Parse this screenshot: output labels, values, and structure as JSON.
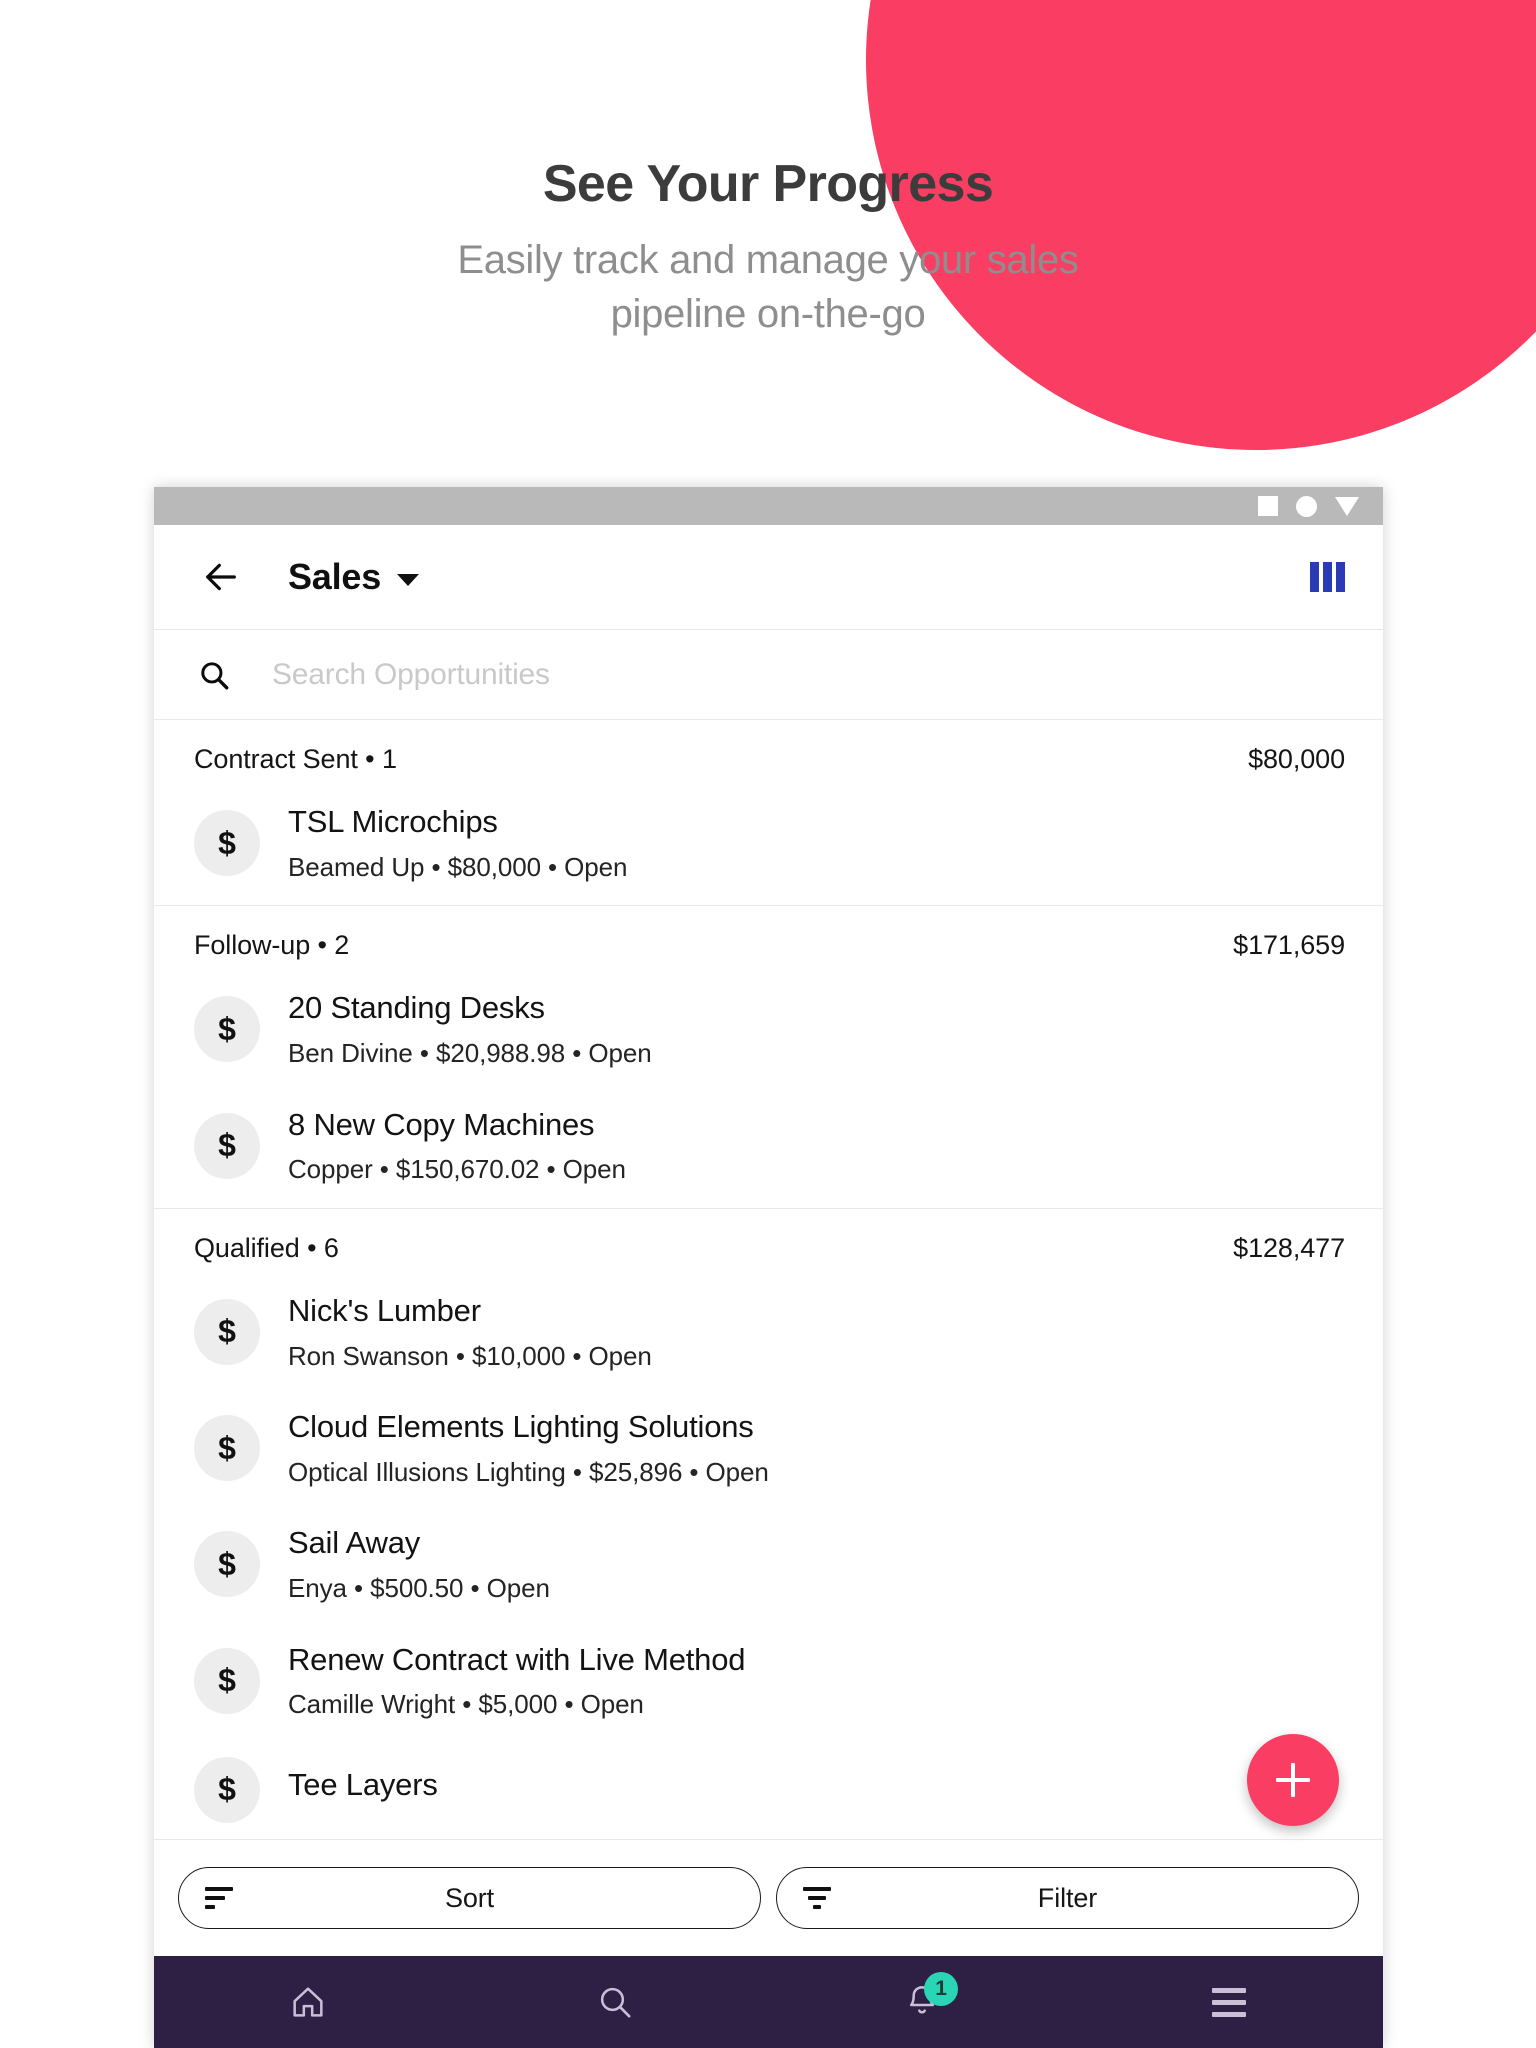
{
  "promo": {
    "title": "See Your Progress",
    "subtitle_line1": "Easily track and manage your sales",
    "subtitle_line2": "pipeline on-the-go"
  },
  "colors": {
    "accent_pink": "#fa3d62",
    "nav_purple": "#2e1f45",
    "badge_teal": "#2ad5b5",
    "kanban_blue": "#2b3bb5"
  },
  "statusbar": {
    "icons": [
      "square-icon",
      "circle-icon",
      "triangle-down-icon"
    ]
  },
  "appbar": {
    "back_icon": "arrow-left-icon",
    "title": "Sales",
    "dropdown_icon": "caret-down-icon",
    "view_toggle_icon": "kanban-columns-icon"
  },
  "search": {
    "icon": "search-icon",
    "placeholder": "Search Opportunities",
    "value": ""
  },
  "groups": [
    {
      "label": "Contract Sent • 1",
      "total": "$80,000",
      "items": [
        {
          "avatar": "$",
          "title": "TSL Microchips",
          "subtitle": "Beamed Up • $80,000 • Open"
        }
      ]
    },
    {
      "label": "Follow-up • 2",
      "total": "$171,659",
      "items": [
        {
          "avatar": "$",
          "title": "20 Standing Desks",
          "subtitle": "Ben Divine • $20,988.98 • Open"
        },
        {
          "avatar": "$",
          "title": "8 New Copy Machines",
          "subtitle": "Copper • $150,670.02 • Open"
        }
      ]
    },
    {
      "label": "Qualified • 6",
      "total": "$128,477",
      "items": [
        {
          "avatar": "$",
          "title": "Nick's Lumber",
          "subtitle": "Ron Swanson • $10,000 • Open"
        },
        {
          "avatar": "$",
          "title": "Cloud Elements Lighting Solutions",
          "subtitle": "Optical Illusions Lighting • $25,896 • Open"
        },
        {
          "avatar": "$",
          "title": "Sail Away",
          "subtitle": "Enya • $500.50 • Open"
        },
        {
          "avatar": "$",
          "title": "Renew Contract with Live Method",
          "subtitle": "Camille Wright • $5,000 • Open"
        },
        {
          "avatar": "$",
          "title": "Tee Layers",
          "subtitle": ""
        }
      ]
    }
  ],
  "fab": {
    "icon": "plus-icon",
    "label": ""
  },
  "toolbar": {
    "sort_label": "Sort",
    "sort_icon": "sort-icon",
    "filter_label": "Filter",
    "filter_icon": "filter-icon"
  },
  "bottomnav": {
    "items": [
      {
        "icon": "home-icon",
        "badge": ""
      },
      {
        "icon": "search-icon",
        "badge": ""
      },
      {
        "icon": "bell-icon",
        "badge": "1"
      },
      {
        "icon": "menu-icon",
        "badge": ""
      }
    ]
  }
}
